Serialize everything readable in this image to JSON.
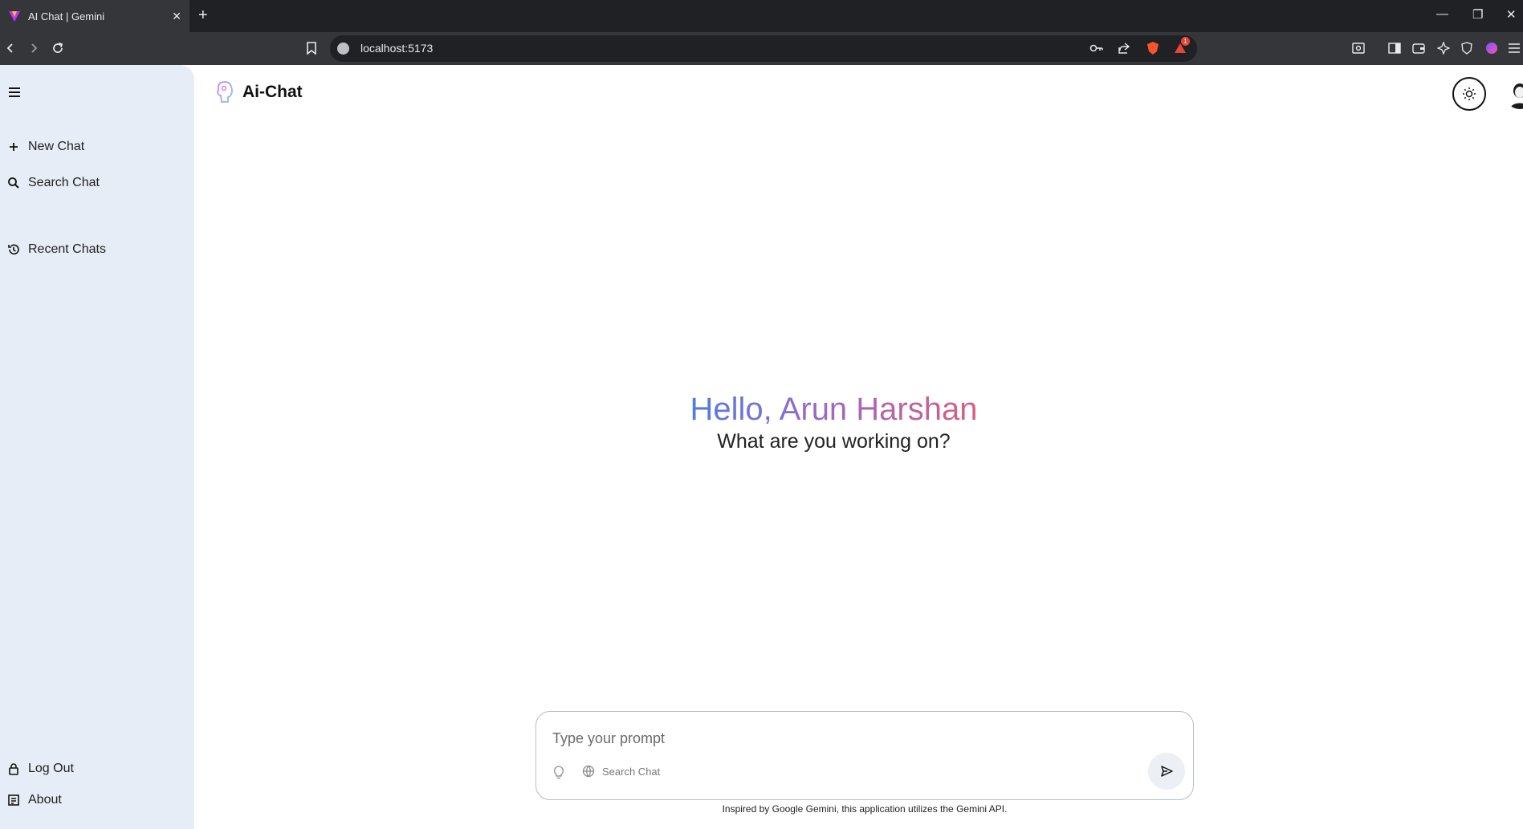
{
  "browser": {
    "tab_title": "AI Chat | Gemini",
    "url": "localhost:5173",
    "notification_count": "1"
  },
  "sidebar": {
    "new_chat": "New Chat",
    "search_chat": "Search Chat",
    "recent_chats": "Recent Chats",
    "log_out": "Log Out",
    "about": "About"
  },
  "header": {
    "title": "Ai-Chat"
  },
  "greeting": {
    "hello": "Hello, Arun Harshan",
    "subtitle": "What are you working on?"
  },
  "prompt": {
    "placeholder": "Type your prompt",
    "search_label": "Search Chat"
  },
  "footer": {
    "note": "Inspired by Google Gemini, this application utilizes the Gemini API."
  },
  "colors": {
    "gradient_start": "#4f7ce0",
    "gradient_mid": "#9b6ac7",
    "gradient_end": "#d6607e",
    "sidebar_bg": "#e7edf6"
  }
}
